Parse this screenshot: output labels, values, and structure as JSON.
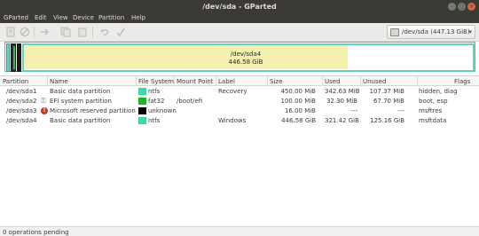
{
  "window": {
    "title": "/dev/sda - GParted"
  },
  "menu": [
    "GParted",
    "Edit",
    "View",
    "Device",
    "Partition",
    "Help"
  ],
  "toolbar": {
    "buttons": [
      "new-icon",
      "delete-icon",
      "resize-icon",
      "copy-icon",
      "paste-icon",
      "undo-icon",
      "apply-icon"
    ]
  },
  "device": {
    "label": "/dev/sda  (447.13 GiB)"
  },
  "diskmap": {
    "selected_name": "/dev/sda4",
    "selected_size": "446.58 GiB",
    "used_fraction": 0.72
  },
  "table": {
    "headers": [
      "Partition",
      "Name",
      "File System",
      "Mount Point",
      "Label",
      "Size",
      "Used",
      "Unused",
      "Flags"
    ],
    "rows": [
      {
        "partition": "/dev/sda1",
        "name": "Basic data partition",
        "fs": "ntfs",
        "fs_color": "#42d6a4",
        "mount": "",
        "label": "Recovery",
        "size": "450.00 MiB",
        "used": "342.63 MiB",
        "unused": "107.37 MiB",
        "flags": "hidden, diag",
        "icon": ""
      },
      {
        "partition": "/dev/sda2",
        "name": "EFI system partition",
        "fs": "fat32",
        "fs_color": "#18b82e",
        "mount": "/boot/efi",
        "label": "",
        "size": "100.00 MiB",
        "used": "32.30 MiB",
        "unused": "67.70 MiB",
        "flags": "boot, esp",
        "icon": "key-icon"
      },
      {
        "partition": "/dev/sda3",
        "name": "Microsoft reserved partition",
        "fs": "unknown",
        "fs_color": "#000000",
        "mount": "",
        "label": "",
        "size": "16.00 MiB",
        "used": "---",
        "unused": "---",
        "flags": "msftres",
        "icon": "warning-icon"
      },
      {
        "partition": "/dev/sda4",
        "name": "Basic data partition",
        "fs": "ntfs",
        "fs_color": "#42d6a4",
        "mount": "",
        "label": "Windows",
        "size": "446.58 GiB",
        "used": "321.42 GiB",
        "unused": "125.16 GiB",
        "flags": "msftdata",
        "icon": ""
      }
    ]
  },
  "status": {
    "text": "0 operations pending"
  }
}
